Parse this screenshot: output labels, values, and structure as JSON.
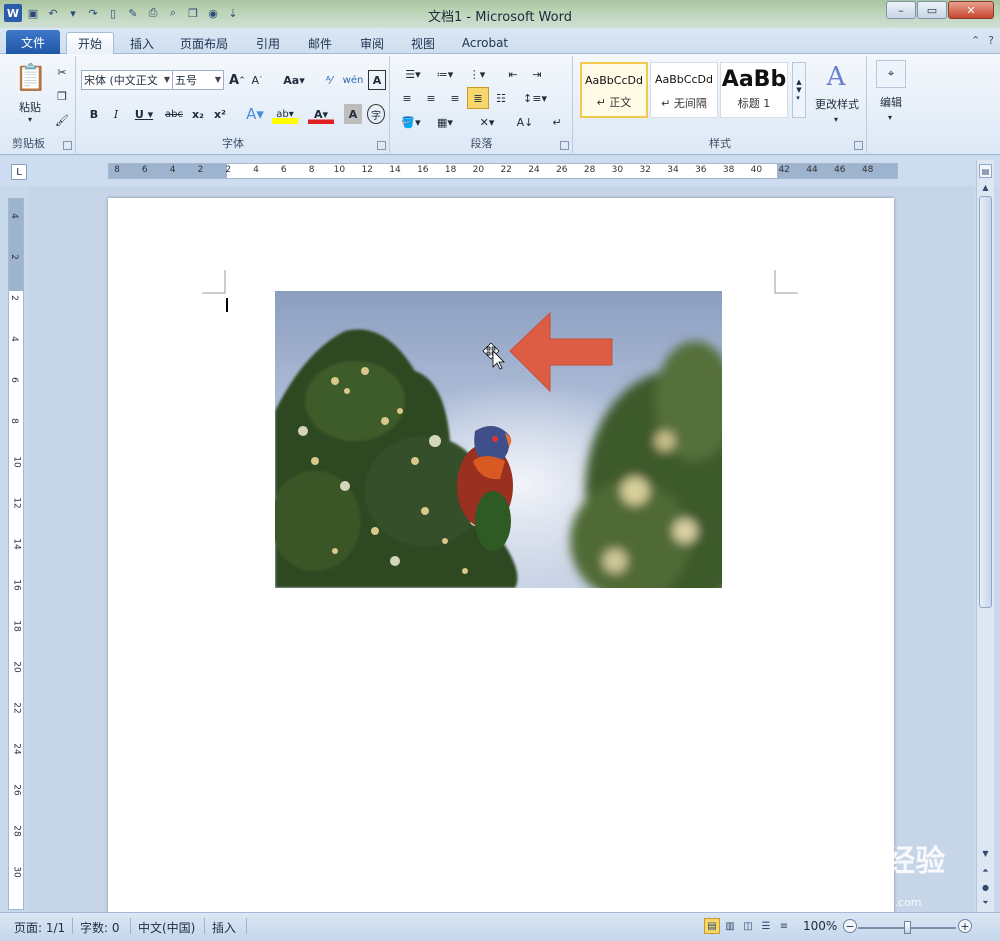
{
  "window": {
    "title": "文档1  -  Microsoft Word",
    "app_icon": "W"
  },
  "tabs": {
    "file": "文件",
    "items": [
      "开始",
      "插入",
      "页面布局",
      "引用",
      "邮件",
      "审阅",
      "视图",
      "Acrobat"
    ],
    "active": "开始"
  },
  "ribbon": {
    "clipboard": {
      "label": "剪贴板",
      "paste": "粘贴"
    },
    "font": {
      "label": "字体",
      "font_name": "宋体 (中文正文",
      "font_size": "五号"
    },
    "paragraph": {
      "label": "段落"
    },
    "styles": {
      "label": "样式",
      "items": [
        {
          "sample": "AaBbCcDd",
          "name": "↵ 正文"
        },
        {
          "sample": "AaBbCcDd",
          "name": "↵ 无间隔"
        },
        {
          "sample": "AaBb",
          "name": "标题 1"
        }
      ],
      "change": "更改样式"
    },
    "editing": {
      "label": "编辑"
    }
  },
  "ruler": {
    "h_numbers": [
      "8",
      "6",
      "4",
      "2",
      "2",
      "4",
      "6",
      "8",
      "10",
      "12",
      "14",
      "16",
      "18",
      "20",
      "22",
      "24",
      "26",
      "28",
      "30",
      "32",
      "34",
      "36",
      "38",
      "40",
      "42",
      "44",
      "46",
      "48"
    ],
    "v_numbers": [
      "4",
      "2",
      "2",
      "4",
      "6",
      "8",
      "10",
      "12",
      "14",
      "16",
      "18",
      "20",
      "22",
      "24",
      "26",
      "28",
      "30"
    ]
  },
  "status": {
    "page": "页面: 1/1",
    "words": "字数: 0",
    "language": "中文(中国)",
    "mode": "插入",
    "zoom": "100%",
    "zoom_level": 1.0
  },
  "watermark": {
    "main": "Bai du 经验",
    "sub": "jingyan.baidu.com"
  },
  "colors": {
    "accent": "#2b579a",
    "arrow": "#e0593c",
    "file_tab": "#2a63b8"
  },
  "icons": [
    "save-icon",
    "undo-icon",
    "redo-icon",
    "new-icon",
    "print-icon",
    "arrow-left-shape"
  ]
}
